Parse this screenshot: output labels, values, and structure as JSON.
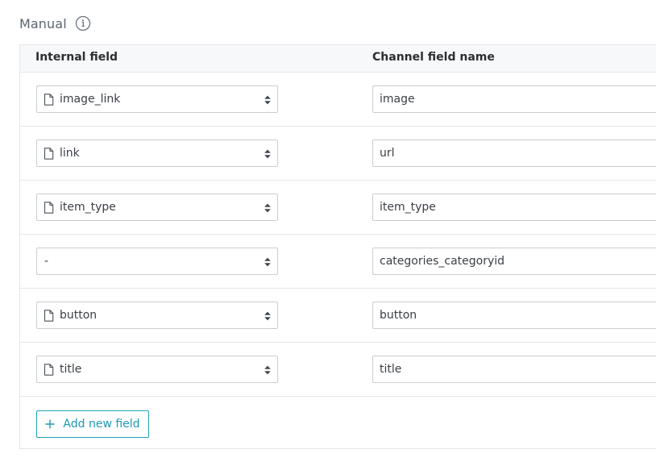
{
  "section": {
    "title": "Manual"
  },
  "table": {
    "headers": {
      "internal": "Internal field",
      "channel": "Channel field name"
    },
    "rows": [
      {
        "internal_field": "image_link",
        "has_icon": true,
        "channel_field": "image"
      },
      {
        "internal_field": "link",
        "has_icon": true,
        "channel_field": "url"
      },
      {
        "internal_field": "item_type",
        "has_icon": true,
        "channel_field": "item_type"
      },
      {
        "internal_field": "-",
        "has_icon": false,
        "channel_field": "categories_categoryid"
      },
      {
        "internal_field": "button",
        "has_icon": true,
        "channel_field": "button"
      },
      {
        "internal_field": "title",
        "has_icon": true,
        "channel_field": "title"
      }
    ]
  },
  "actions": {
    "add_new_field": "Add new field"
  },
  "colors": {
    "accent": "#1a9ab3",
    "border": "#c9cdd2",
    "header_bg": "#f7f8f9"
  },
  "icons": {
    "info": "info-icon",
    "field": "file-icon",
    "select": "sort-icon",
    "add": "plus-icon"
  }
}
